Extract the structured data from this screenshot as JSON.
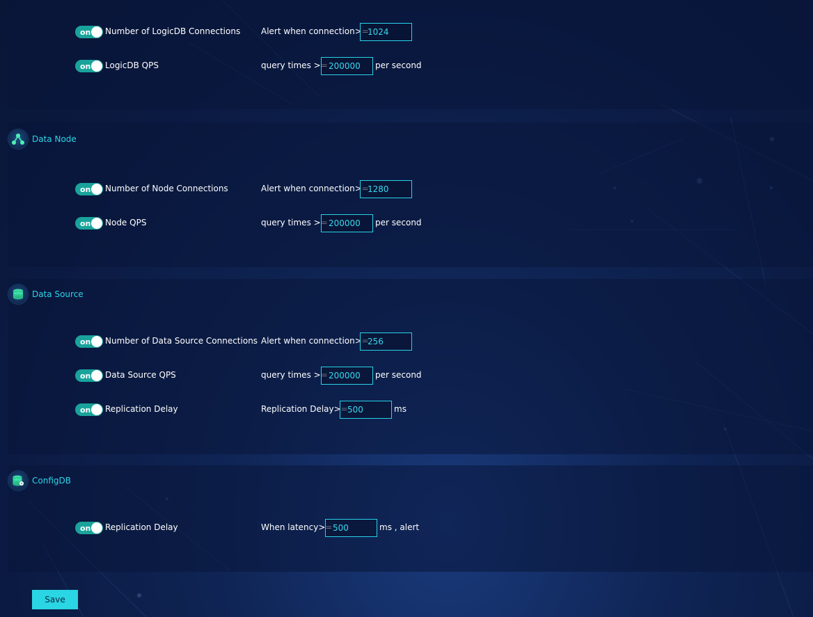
{
  "sections": {
    "logicdb": {
      "rows": [
        {
          "toggle": "on",
          "label": "Number of LogicDB Connections",
          "condition": "Alert when connection>=",
          "value": "1024",
          "unit": ""
        },
        {
          "toggle": "on",
          "label": "LogicDB QPS",
          "condition": "query times >=",
          "value": "200000",
          "unit": "per second"
        }
      ]
    },
    "datanode": {
      "title": "Data Node",
      "rows": [
        {
          "toggle": "on",
          "label": "Number of Node Connections",
          "condition": "Alert when connection>=",
          "value": "1280",
          "unit": ""
        },
        {
          "toggle": "on",
          "label": "Node QPS",
          "condition": "query times >=",
          "value": "200000",
          "unit": "per second"
        }
      ]
    },
    "datasource": {
      "title": "Data Source",
      "rows": [
        {
          "toggle": "on",
          "label": "Number of Data Source Connections",
          "condition": "Alert when connection>=",
          "value": "256",
          "unit": ""
        },
        {
          "toggle": "on",
          "label": "Data Source QPS",
          "condition": "query times >=",
          "value": "200000",
          "unit": "per second"
        },
        {
          "toggle": "on",
          "label": "Replication Delay",
          "condition": "Replication Delay>=",
          "value": "500",
          "unit": "ms"
        }
      ]
    },
    "configdb": {
      "title": "ConfigDB",
      "rows": [
        {
          "toggle": "on",
          "label": "Replication Delay",
          "condition": "When latency>=",
          "value": "500",
          "unit": "ms , alert"
        }
      ]
    }
  },
  "save_label": "Save",
  "icons": {
    "datanode": "network-node-icon",
    "datasource": "database-icon",
    "configdb": "database-config-icon"
  },
  "colors": {
    "accent": "#2fd3e6",
    "toggle_on": "#1aa39b",
    "input_border": "#29d3e8",
    "save_bg": "#2ad6e3"
  }
}
